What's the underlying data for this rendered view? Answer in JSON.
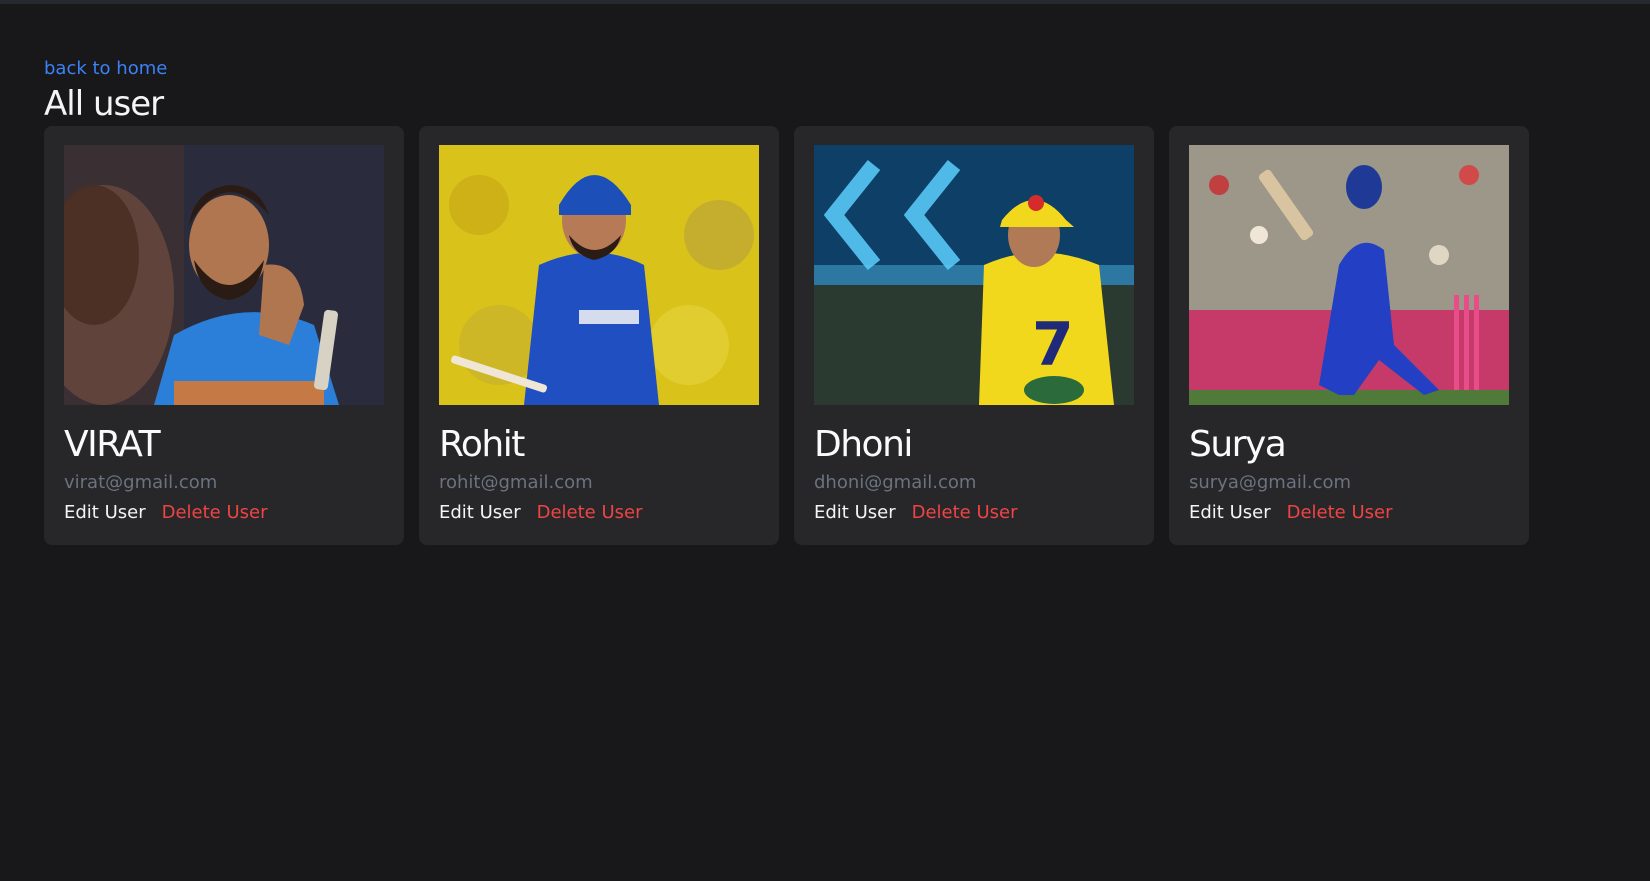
{
  "nav": {
    "back_label": "back to home"
  },
  "page": {
    "title": "All user"
  },
  "users": [
    {
      "name": "VIRAT",
      "email": "virat@gmail.com",
      "edit_label": "Edit User",
      "delete_label": "Delete User",
      "photo_icon": "cricketer-photo",
      "jersey_color": "#2b7fd8",
      "bg_color": "#2a2c3d"
    },
    {
      "name": "Rohit",
      "email": "rohit@gmail.com",
      "edit_label": "Edit User",
      "delete_label": "Delete User",
      "photo_icon": "cricketer-photo",
      "jersey_color": "#1f4fc0",
      "bg_color": "#d9c21a"
    },
    {
      "name": "Dhoni",
      "email": "dhoni@gmail.com",
      "edit_label": "Edit User",
      "delete_label": "Delete User",
      "photo_icon": "cricketer-photo",
      "jersey_color": "#f2d81c",
      "bg_color": "#0e3f66"
    },
    {
      "name": "Surya",
      "email": "surya@gmail.com",
      "edit_label": "Edit User",
      "delete_label": "Delete User",
      "photo_icon": "cricketer-photo",
      "jersey_color": "#2340c4",
      "bg_color": "#8a8470"
    }
  ],
  "theme": {
    "link_color": "#3b82f6",
    "delete_color": "#ef4444",
    "card_bg": "#27272a",
    "page_bg": "#18181b"
  }
}
